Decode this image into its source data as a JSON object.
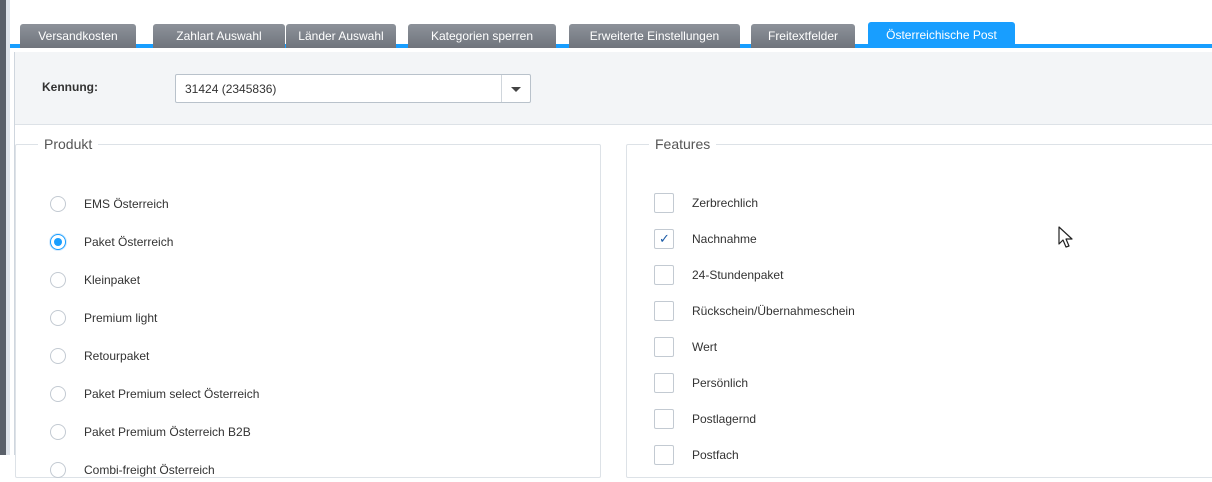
{
  "tabs": [
    {
      "label": "Versandkosten",
      "active": false
    },
    {
      "label": "Zahlart Auswahl",
      "active": false
    },
    {
      "label": "Länder Auswahl",
      "active": false
    },
    {
      "label": "Kategorien sperren",
      "active": false
    },
    {
      "label": "Erweiterte Einstellungen",
      "active": false
    },
    {
      "label": "Freitextfelder",
      "active": false
    },
    {
      "label": "Österreichische Post",
      "active": true
    }
  ],
  "form": {
    "kennung_label": "Kennung:",
    "kennung_value": "31424 (2345836)"
  },
  "produkt": {
    "legend": "Produkt",
    "options": [
      {
        "label": "EMS Österreich",
        "checked": false
      },
      {
        "label": "Paket Österreich",
        "checked": true
      },
      {
        "label": "Kleinpaket",
        "checked": false
      },
      {
        "label": "Premium light",
        "checked": false
      },
      {
        "label": "Retourpaket",
        "checked": false
      },
      {
        "label": "Paket Premium select Österreich",
        "checked": false
      },
      {
        "label": "Paket Premium Österreich B2B",
        "checked": false
      },
      {
        "label": "Combi-freight Österreich",
        "checked": false
      }
    ]
  },
  "features": {
    "legend": "Features",
    "options": [
      {
        "label": "Zerbrechlich",
        "checked": false
      },
      {
        "label": "Nachnahme",
        "checked": true
      },
      {
        "label": "24-Stundenpaket",
        "checked": false
      },
      {
        "label": "Rückschein/Übernahmeschein",
        "checked": false
      },
      {
        "label": "Wert",
        "checked": false
      },
      {
        "label": "Persönlich",
        "checked": false
      },
      {
        "label": "Postlagernd",
        "checked": false
      },
      {
        "label": "Postfach",
        "checked": false
      }
    ]
  },
  "colors": {
    "accent": "#189eff",
    "tab_inactive": "#7d828a",
    "form_row_bg": "#f3f5f7"
  }
}
